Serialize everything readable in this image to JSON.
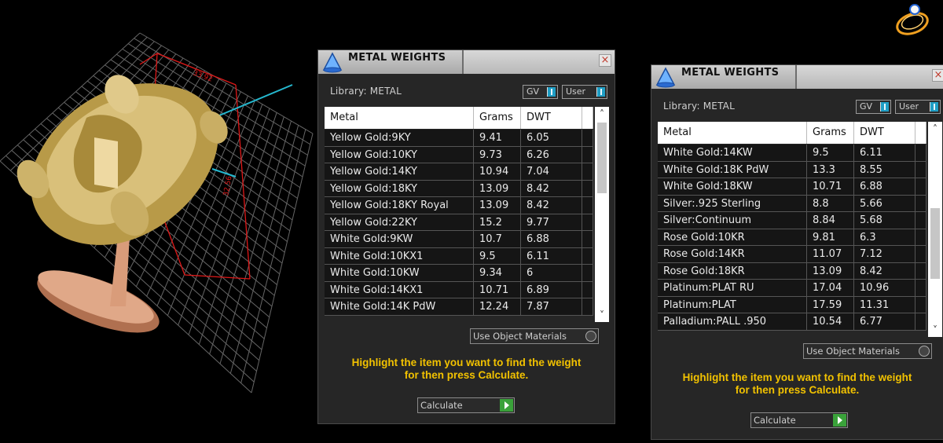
{
  "viewport": {},
  "panels": [
    {
      "title": "METAL WEIGHTS",
      "library_label": "Library: METAL",
      "toggle_gv": "GV",
      "toggle_user": "User",
      "columns": [
        "Metal",
        "Grams",
        "DWT"
      ],
      "rows": [
        [
          "Yellow Gold:9KY",
          "9.41",
          "6.05"
        ],
        [
          "Yellow Gold:10KY",
          "9.73",
          "6.26"
        ],
        [
          "Yellow Gold:14KY",
          "10.94",
          "7.04"
        ],
        [
          "Yellow Gold:18KY",
          "13.09",
          "8.42"
        ],
        [
          "Yellow Gold:18KY Royal",
          "13.09",
          "8.42"
        ],
        [
          "Yellow Gold:22KY",
          "15.2",
          "9.77"
        ],
        [
          "White Gold:9KW",
          "10.7",
          "6.88"
        ],
        [
          "White Gold:10KX1",
          "9.5",
          "6.11"
        ],
        [
          "White Gold:10KW",
          "9.34",
          "6"
        ],
        [
          "White Gold:14KX1",
          "10.71",
          "6.89"
        ],
        [
          "White Gold:14K PdW",
          "12.24",
          "7.87"
        ]
      ],
      "use_object_materials": "Use Object Materials",
      "hint_line1": "Highlight the item you want to find the weight",
      "hint_line2": "for then press Calculate.",
      "calculate_label": "Calculate",
      "close_symbol": "×"
    },
    {
      "title": "METAL WEIGHTS",
      "library_label": "Library: METAL",
      "toggle_gv": "GV",
      "toggle_user": "User",
      "columns": [
        "Metal",
        "Grams",
        "DWT"
      ],
      "rows": [
        [
          "White Gold:14KW",
          "9.5",
          "6.11"
        ],
        [
          "White Gold:18K PdW",
          "13.3",
          "8.55"
        ],
        [
          "White Gold:18KW",
          "10.71",
          "6.88"
        ],
        [
          "Silver:.925 Sterling",
          "8.8",
          "5.66"
        ],
        [
          "Silver:Continuum",
          "8.84",
          "5.68"
        ],
        [
          "Rose Gold:10KR",
          "9.81",
          "6.3"
        ],
        [
          "Rose Gold:14KR",
          "11.07",
          "7.12"
        ],
        [
          "Rose Gold:18KR",
          "13.09",
          "8.42"
        ],
        [
          "Platinum:PLAT RU",
          "17.04",
          "10.96"
        ],
        [
          "Platinum:PLAT",
          "17.59",
          "11.31"
        ],
        [
          "Palladium:PALL .950",
          "10.54",
          "6.77"
        ]
      ],
      "use_object_materials": "Use Object Materials",
      "hint_line1": "Highlight the item you want to find the weight",
      "hint_line2": "for then press Calculate.",
      "calculate_label": "Calculate",
      "close_symbol": "×"
    }
  ],
  "icons": {
    "scroll_up": "˄",
    "scroll_down": "˅"
  }
}
